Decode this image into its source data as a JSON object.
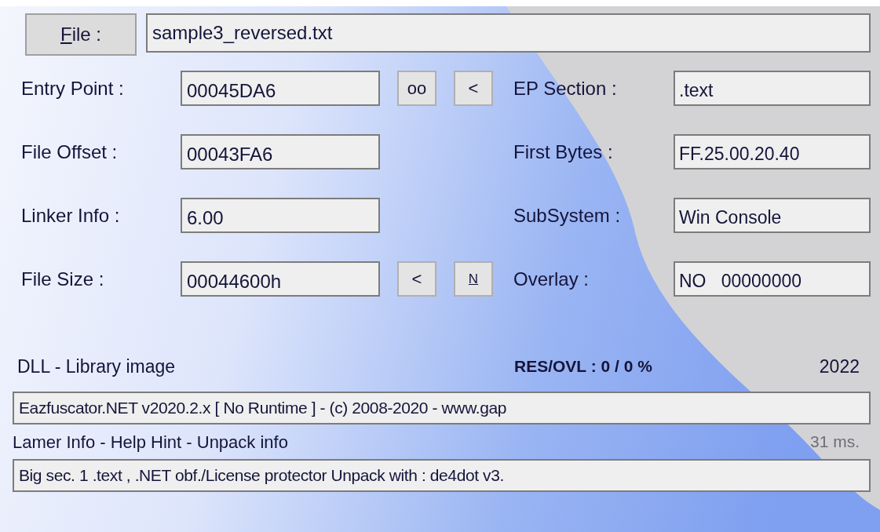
{
  "file_button": {
    "label": "File :"
  },
  "file_field": {
    "value": "sample3_reversed.txt"
  },
  "rows": [
    {
      "left": {
        "label": "Entry Point :",
        "value": "00045DA6"
      },
      "buttons": [
        {
          "label": "oo",
          "underline": false
        },
        {
          "label": "<",
          "underline": false
        }
      ],
      "right": {
        "label": "EP Section :",
        "value": ".text"
      }
    },
    {
      "left": {
        "label": "File Offset :",
        "value": "00043FA6"
      },
      "buttons": [],
      "right": {
        "label": "First Bytes :",
        "value": "FF.25.00.20.40"
      }
    },
    {
      "left": {
        "label": "Linker Info :",
        "value": "6.00"
      },
      "buttons": [],
      "right": {
        "label": "SubSystem :",
        "value": "Win Console"
      }
    },
    {
      "left": {
        "label": "File Size :",
        "value": "00044600h"
      },
      "buttons": [
        {
          "label": "<",
          "underline": false
        },
        {
          "label": "N",
          "underline": true
        }
      ],
      "right": {
        "label": "Overlay :",
        "value": "NO   00000000"
      }
    }
  ],
  "image_type": "DLL - Library image",
  "res_ovl": "RES/OVL : 0 / 0 %",
  "year": "2022",
  "detection": "Eazfuscator.NET v2020.2.x [ No Runtime ] - (c) 2008-2020 - www.gap",
  "info_links": "Lamer Info - Help Hint - Unpack info",
  "scan_time": "31 ms.",
  "hint": "Big sec. 1 .text , .NET obf./License protector Unpack with : de4dot v3."
}
